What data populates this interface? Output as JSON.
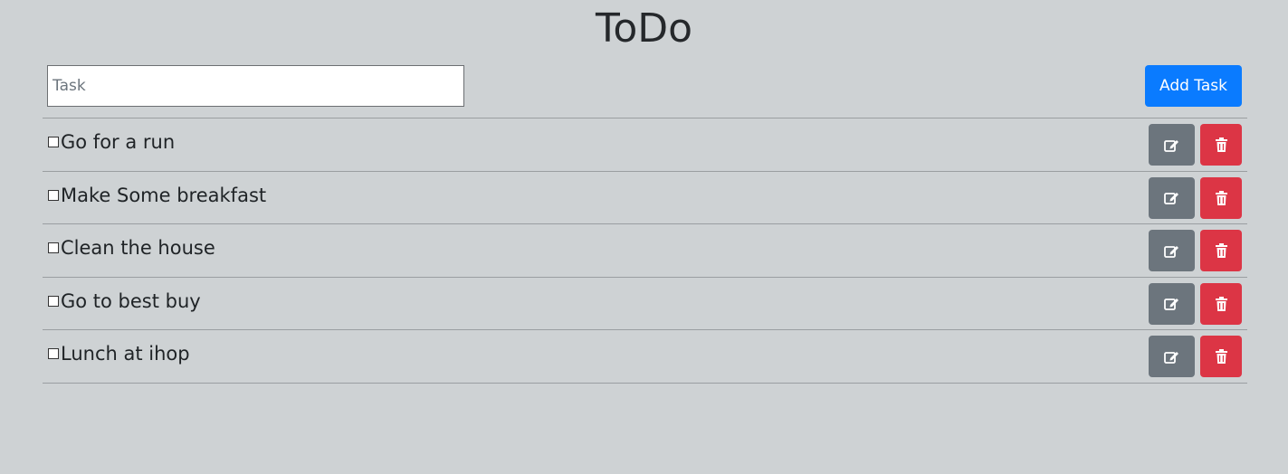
{
  "app": {
    "title": "ToDo"
  },
  "input": {
    "placeholder": "Task",
    "value": ""
  },
  "add_button": {
    "label": "Add Task"
  },
  "tasks": [
    {
      "label": "Go for a run",
      "checked": false
    },
    {
      "label": "Make Some breakfast",
      "checked": false
    },
    {
      "label": "Clean the house",
      "checked": false
    },
    {
      "label": "Go to best buy",
      "checked": false
    },
    {
      "label": "Lunch at ihop",
      "checked": false
    }
  ],
  "icons": {
    "edit": "edit-icon",
    "delete": "trash-icon"
  },
  "colors": {
    "background": "#ced2d4",
    "primary": "#0a7bff",
    "secondary": "#6c757d",
    "danger": "#dc3545"
  }
}
